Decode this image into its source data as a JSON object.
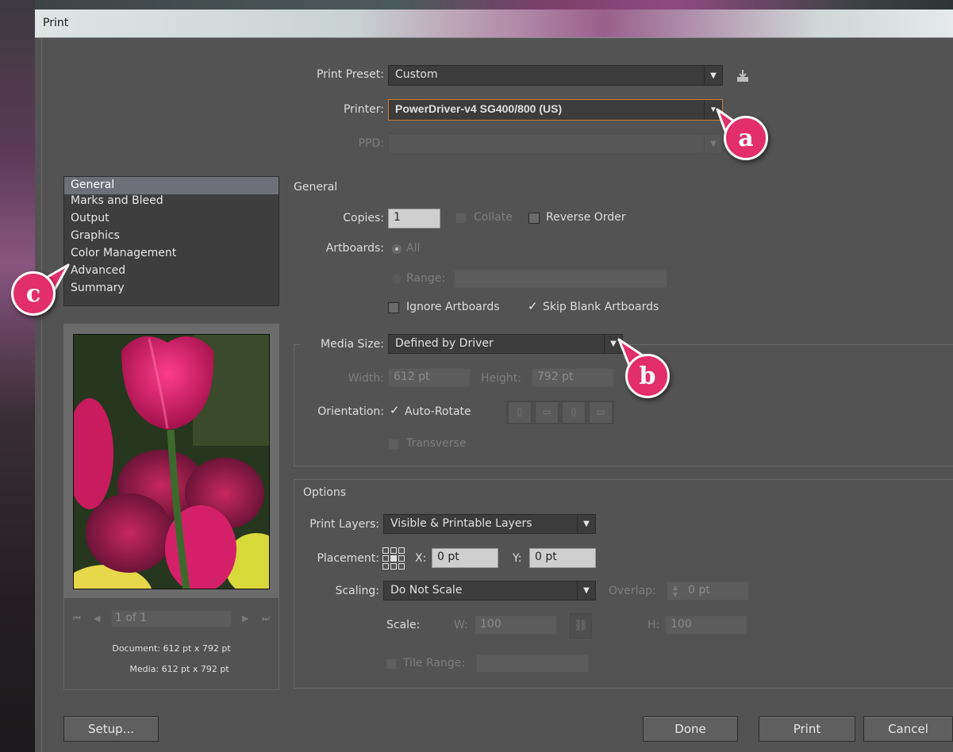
{
  "window": {
    "title": "Print"
  },
  "top": {
    "preset_label": "Print Preset:",
    "preset_value": "Custom",
    "printer_label": "Printer:",
    "printer_value": "PowerDriver-v4 SG400/800 (US)",
    "ppd_label": "PPD:",
    "ppd_value": ""
  },
  "sidebar": {
    "items": [
      {
        "label": "General",
        "selected": true
      },
      {
        "label": "Marks and Bleed"
      },
      {
        "label": "Output"
      },
      {
        "label": "Graphics"
      },
      {
        "label": "Color Management"
      },
      {
        "label": "Advanced"
      },
      {
        "label": "Summary"
      }
    ]
  },
  "preview": {
    "page_field": "1 of 1",
    "document_info": "Document: 612 pt x 792 pt",
    "media_info": "Media: 612 pt x 792 pt"
  },
  "general": {
    "heading": "General",
    "copies_label": "Copies:",
    "copies_value": "1",
    "collate_label": "Collate",
    "reverse_label": "Reverse Order",
    "artboards_label": "Artboards:",
    "all_label": "All",
    "range_label": "Range:",
    "ignore_label": "Ignore Artboards",
    "skip_label": "Skip Blank Artboards"
  },
  "media": {
    "size_label": "Media Size:",
    "size_value": "Defined by Driver",
    "width_label": "Width:",
    "width_value": "612 pt",
    "height_label": "Height:",
    "height_value": "792 pt",
    "orientation_label": "Orientation:",
    "autorotate_label": "Auto-Rotate",
    "transverse_label": "Transverse"
  },
  "options": {
    "heading": "Options",
    "layers_label": "Print Layers:",
    "layers_value": "Visible & Printable Layers",
    "placement_label": "Placement:",
    "x_label": "X:",
    "x_value": "0 pt",
    "y_label": "Y:",
    "y_value": "0 pt",
    "scaling_label": "Scaling:",
    "scaling_value": "Do Not Scale",
    "overlap_label": "Overlap:",
    "overlap_value": "0 pt",
    "scale_label": "Scale:",
    "w_label": "W:",
    "w_value": "100",
    "h_label": "H:",
    "h_value": "100",
    "tile_label": "Tile Range:"
  },
  "buttons": {
    "setup": "Setup...",
    "done": "Done",
    "print": "Print",
    "cancel": "Cancel"
  },
  "callouts": {
    "a": "a",
    "b": "b",
    "c": "c"
  },
  "colors": {
    "accent": "#e22e6a",
    "dialog_bg": "#535353",
    "field_bg": "#3c3c3c",
    "printer_focus": "#c87a3a"
  }
}
